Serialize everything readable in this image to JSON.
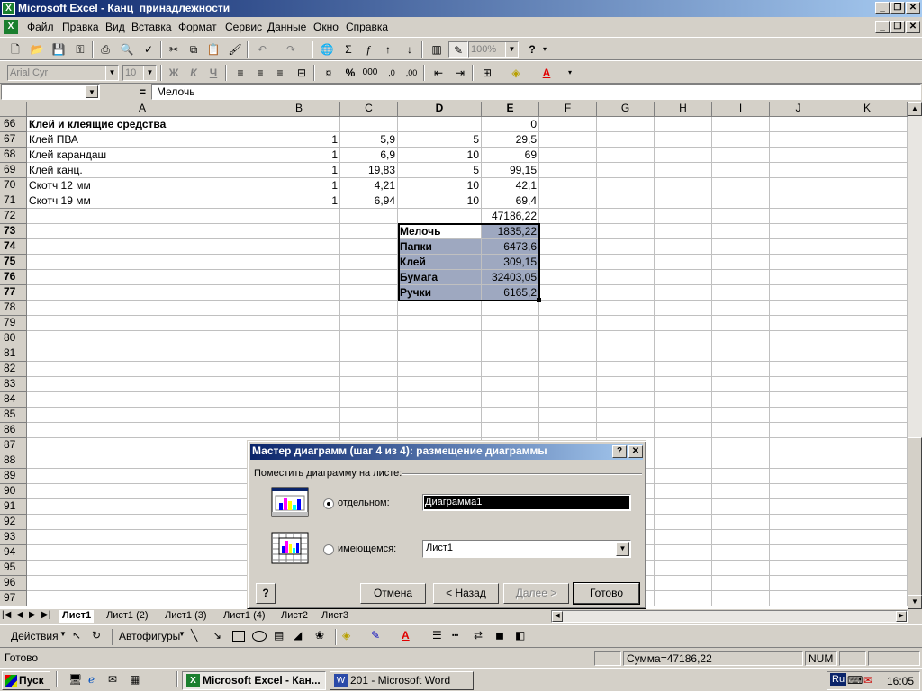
{
  "window": {
    "title": "Microsoft Excel - Канц_принадлежности",
    "app_icon": "excel-icon"
  },
  "menu": [
    {
      "label": "Файл"
    },
    {
      "label": "Правка"
    },
    {
      "label": "Вид"
    },
    {
      "label": "Вставка"
    },
    {
      "label": "Формат"
    },
    {
      "label": "Сервис"
    },
    {
      "label": "Данные"
    },
    {
      "label": "Окно"
    },
    {
      "label": "Справка"
    }
  ],
  "toolbar": {
    "zoom": "100%",
    "font": "Arial Cyr",
    "font_size": "10",
    "bold": "Ж",
    "italic": "К",
    "underline": "Ч",
    "percent": "%",
    "thousands": "000",
    "sigma": "Σ",
    "fx": "f",
    "help": "?"
  },
  "formula_bar": {
    "name_box": "",
    "equals": "=",
    "value": "Мелочь"
  },
  "columns": [
    {
      "label": "A"
    },
    {
      "label": "B"
    },
    {
      "label": "C"
    },
    {
      "label": "D"
    },
    {
      "label": "E"
    },
    {
      "label": "F"
    },
    {
      "label": "G"
    },
    {
      "label": "H"
    },
    {
      "label": "I"
    },
    {
      "label": "J"
    },
    {
      "label": "K"
    }
  ],
  "rows": [
    {
      "num": "66",
      "a": "Клей и клеящие средства",
      "b": "",
      "c": "",
      "d": "",
      "e": "0"
    },
    {
      "num": "67",
      "a": "Клей ПВА",
      "b": "1",
      "c": "5,9",
      "d": "5",
      "e": "29,5"
    },
    {
      "num": "68",
      "a": "Клей карандаш",
      "b": "1",
      "c": "6,9",
      "d": "10",
      "e": "69"
    },
    {
      "num": "69",
      "a": "Клей канц.",
      "b": "1",
      "c": "19,83",
      "d": "5",
      "e": "99,15"
    },
    {
      "num": "70",
      "a": "Скотч 12 мм",
      "b": "1",
      "c": "4,21",
      "d": "10",
      "e": "42,1"
    },
    {
      "num": "71",
      "a": "Скотч 19 мм",
      "b": "1",
      "c": "6,94",
      "d": "10",
      "e": "69,4"
    },
    {
      "num": "72",
      "a": "",
      "b": "",
      "c": "",
      "d": "",
      "e": "47186,22"
    },
    {
      "num": "73",
      "a": "",
      "b": "",
      "c": "",
      "d": "Мелочь",
      "e": "1835,22"
    },
    {
      "num": "74",
      "a": "",
      "b": "",
      "c": "",
      "d": "Папки",
      "e": "6473,6"
    },
    {
      "num": "75",
      "a": "",
      "b": "",
      "c": "",
      "d": "Клей",
      "e": "309,15"
    },
    {
      "num": "76",
      "a": "",
      "b": "",
      "c": "",
      "d": "Бумага",
      "e": "32403,05"
    },
    {
      "num": "77",
      "a": "",
      "b": "",
      "c": "",
      "d": "Ручки",
      "e": "6165,2"
    },
    {
      "num": "78"
    },
    {
      "num": "79"
    },
    {
      "num": "80"
    },
    {
      "num": "81"
    },
    {
      "num": "82"
    },
    {
      "num": "83"
    },
    {
      "num": "84"
    },
    {
      "num": "85"
    },
    {
      "num": "86"
    },
    {
      "num": "87"
    },
    {
      "num": "88"
    },
    {
      "num": "89"
    },
    {
      "num": "90"
    },
    {
      "num": "91"
    },
    {
      "num": "92"
    },
    {
      "num": "93"
    },
    {
      "num": "94"
    },
    {
      "num": "95"
    },
    {
      "num": "96"
    },
    {
      "num": "97"
    }
  ],
  "sheet_tabs": [
    "Лист1",
    "Лист1 (2)",
    "Лист1 (3)",
    "Лист1 (4)",
    "Лист2",
    "Лист3"
  ],
  "drawing_toolbar": {
    "actions": "Действия",
    "autoshapes": "Автофигуры"
  },
  "status_bar": {
    "ready": "Готово",
    "sum": "Сумма=47186,22",
    "num": "NUM"
  },
  "taskbar": {
    "start": "Пуск",
    "excel": "Microsoft Excel - Кан...",
    "word": "201 - Microsoft Word",
    "lang": "Ru",
    "clock": "16:05"
  },
  "dialog": {
    "title": "Мастер диаграмм (шаг 4 из 4): размещение диаграммы",
    "help_btn": "?",
    "close_btn": "✕",
    "group_label": "Поместить диаграмму на листе:",
    "option_separate": "отдельном:",
    "option_separate_value": "Диаграмма1",
    "option_existing": "имеющемся:",
    "option_existing_value": "Лист1",
    "cancel": "Отмена",
    "back": "< Назад",
    "next": "Далее >",
    "finish": "Готово"
  }
}
